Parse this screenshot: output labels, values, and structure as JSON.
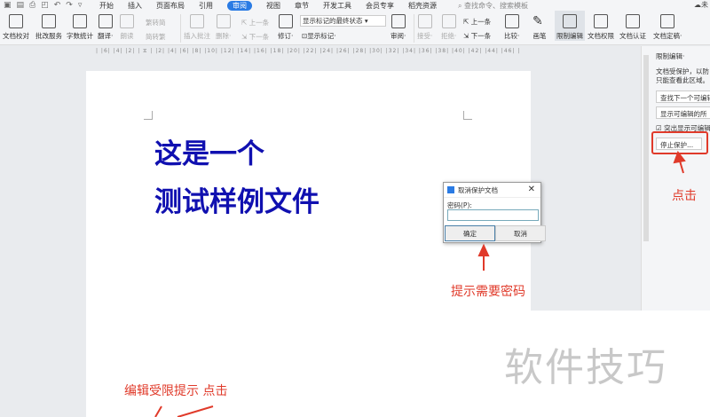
{
  "quick_access": [
    "save-icon",
    "export-icon",
    "print-icon",
    "preview-icon",
    "undo-icon",
    "redo-icon",
    "more-icon"
  ],
  "tabs": [
    "开始",
    "插入",
    "页面布局",
    "引用",
    "审阅",
    "视图",
    "章节",
    "开发工具",
    "会员专享",
    "稻壳资源"
  ],
  "active_tab": "审阅",
  "search_placeholder": "查找命令、搜索模板",
  "cloud": "未",
  "ribbon": {
    "proofread": "文档校对",
    "correction": "批改服务",
    "wordcount": "字数统计",
    "translate": "翻译·",
    "read": "朗读",
    "t2s": "繁转简",
    "s2t": "简转繁",
    "insert_comment": "插入批注",
    "delete": "删除·",
    "prev": "上一条",
    "next": "下一条",
    "revise": "修订·",
    "markup_state": "显示标记的最终状态",
    "show_markup": "显示标记·",
    "review": "审阅·",
    "accept": "接受·",
    "reject": "拒绝·",
    "prev2": "上一条",
    "next2": "下一条",
    "compare": "比较·",
    "pen": "画笔",
    "restrict": "限制编辑",
    "permission": "文档权限",
    "certify": "文档认证",
    "finalize": "文档定稿·"
  },
  "ruler": "| |6| |4| |2| | ⧖ | |2| |4| |6| |8| |10| |12| |14| |16| |18| |20| |22| |24| |26| |28| |30| |32| |34| |36| |38| |40| |42| |44| |46| |",
  "document": {
    "line1": "这是一个",
    "line2": "测试样例文件"
  },
  "panel": {
    "title": "限制编辑·",
    "desc1": "文档受保护，以防",
    "desc2": "只能查看此区域。",
    "find_next": "查找下一个可编辑",
    "show_all": "显示可编辑的所",
    "highlight": "突出显示可编辑",
    "stop": "停止保护..."
  },
  "dialog": {
    "title": "取消保护文档",
    "label": "密码(P):",
    "password": "",
    "ok": "确定",
    "cancel": "取消"
  },
  "annotations": {
    "click_right": "点击",
    "need_password": "提示需要密码",
    "bottom": "编辑受限提示  点击"
  },
  "watermark": "软件技巧",
  "accent": "#2a7be4",
  "annotation_color": "#e03a2a"
}
